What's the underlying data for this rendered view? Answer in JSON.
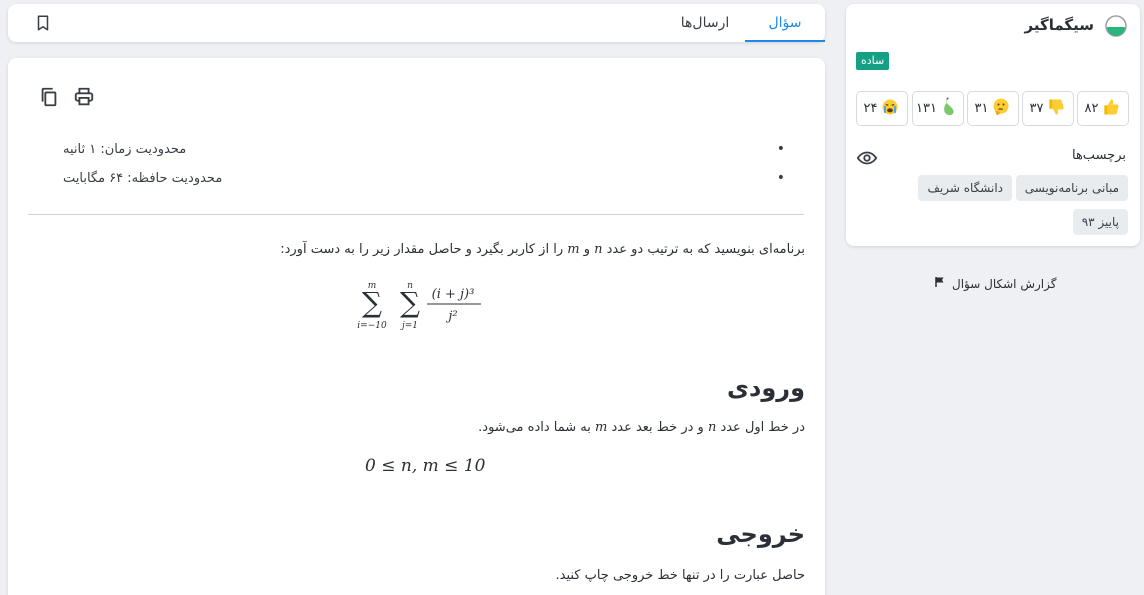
{
  "tabs": {
    "question": "سؤال",
    "submissions": "ارسال‌ها"
  },
  "limits": {
    "time": "محدودیت زمان: ۱ ثانیه",
    "memory": "محدودیت حافظه: ۶۴ مگابایت"
  },
  "statement": {
    "part1": "برنامه‌ای بنویسید که به ترتیب دو عدد ",
    "var_n": "n",
    "part2": " و ",
    "var_m": "m",
    "part3": " را از کاربر بگیرد و حاصل مقدار زیر را به دست آورد:"
  },
  "formula": {
    "outer_upper": "m",
    "outer_lower": "i=−10",
    "inner_upper": "n",
    "inner_lower": "j=1",
    "numerator": "(i + j)³",
    "denominator": "j²"
  },
  "input": {
    "heading": "ورودی",
    "part1": "در خط اول عدد ",
    "var_n": "n",
    "part2": " و در خط بعد عدد ",
    "var_m": "m",
    "part3": " به شما داده می‌شود.",
    "constraint": "0 ≤ n, m ≤ 10"
  },
  "output": {
    "heading": "خروجی",
    "text": "حاصل عبارت را در تنها خط خروجی چاپ کنید."
  },
  "sidebar": {
    "title": "سیگماگیر",
    "level": "ساده",
    "reactions": [
      {
        "icon": "thumbs-up-icon",
        "count": "۸۲"
      },
      {
        "icon": "thumbs-down-icon",
        "count": "۳۷"
      },
      {
        "icon": "thinking-face-icon",
        "count": "۳۱"
      },
      {
        "icon": "pear-icon",
        "count": "۱۳۱"
      },
      {
        "icon": "crying-face-icon",
        "count": "۲۴"
      }
    ],
    "tags_label": "برچسب‌ها",
    "tags": [
      "مبانی برنامه‌نویسی",
      "دانشگاه شریف",
      "پاییز ۹۳"
    ]
  },
  "report": "گزارش اشکال سؤال",
  "colors": {
    "accent": "#1e88e5",
    "level_badge": "#14a085",
    "tag_bg": "#e9ecef"
  }
}
